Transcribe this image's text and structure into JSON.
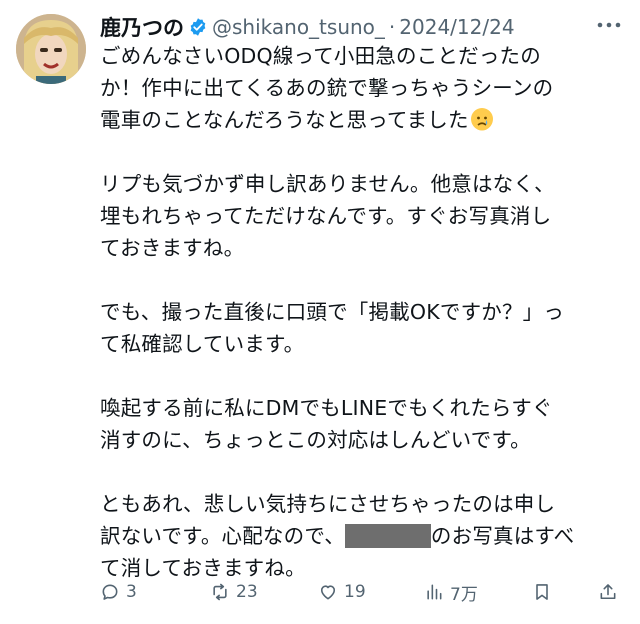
{
  "tweet": {
    "display_name": "鹿乃つの",
    "handle": "@shikano_tsuno_",
    "separator": "·",
    "date": "2024/12/24",
    "paragraphs": [
      {
        "lines": [
          "ごめんなさいODQ線って小田急のことだったの",
          "か！作中に出てくるあの銃で撃っちゃうシーンの"
        ],
        "tail_before_emoji": "電車のことなんだろうなと思ってました"
      },
      {
        "lines": [
          "リプも気づかず申し訳ありません。他意はなく、",
          "埋もれちゃってただけなんです。すぐお写真消し",
          "ておきますね。"
        ]
      },
      {
        "lines": [
          "でも、撮った直後に口頭で「掲載OKですか？」っ",
          "て私確認しています。"
        ]
      },
      {
        "lines": [
          "喚起する前に私にDMでもLINEでもくれたらすぐ",
          "消すのに、ちょっとこの対応はしんどいです。"
        ]
      },
      {
        "line1": "ともあれ、悲しい気持ちにさせちゃったのは申し",
        "line2_before": "訳ないです。心配なので、",
        "line2_after": "のお写真はすべ",
        "line3": "て消しておきますね。"
      }
    ],
    "emoji_name": "sad-face-emoji",
    "verified_icon": "verified-badge-icon"
  },
  "actions": {
    "reply_count": "3",
    "retweet_count": "23",
    "like_count": "19",
    "views_count": "7万"
  },
  "colors": {
    "text": "#0f1419",
    "muted": "#536471",
    "verified": "#1d9bf0"
  }
}
